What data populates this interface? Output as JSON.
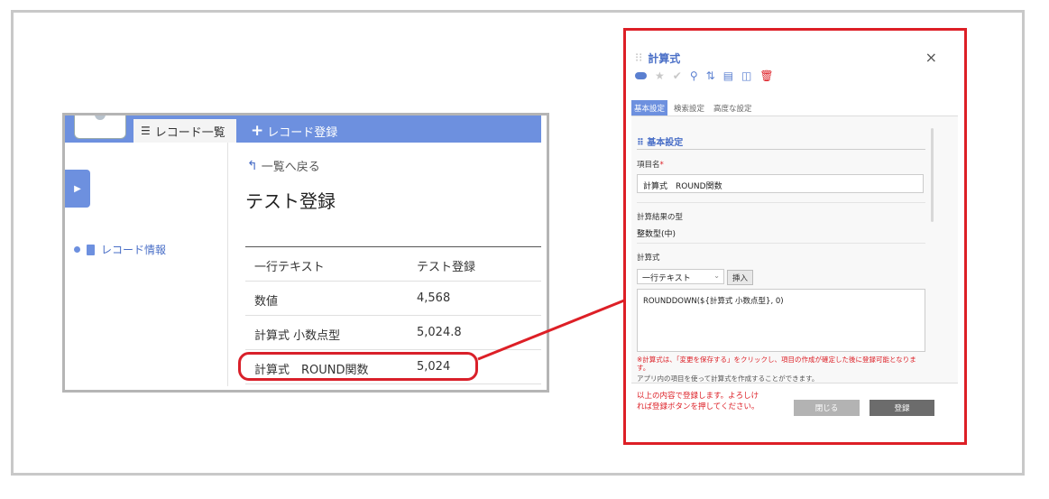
{
  "left": {
    "tabs": {
      "list_label": "レコード一覧",
      "add_label": "レコード登録"
    },
    "sidebar_item": "レコード情報",
    "back_label": "一覧へ戻る",
    "title": "テスト登録",
    "rows": [
      {
        "key": "一行テキスト",
        "value": "テスト登録"
      },
      {
        "key": "数値",
        "value": "4,568"
      },
      {
        "key": "計算式 小数点型",
        "value": "5,024.8"
      },
      {
        "key": "計算式　ROUND関数",
        "value": "5,024"
      }
    ]
  },
  "dialog": {
    "title": "計算式",
    "close_icon": "×",
    "tabs": [
      "基本設定",
      "検索設定",
      "高度な設定"
    ],
    "section": "基本設定",
    "field_name_label": "項目名",
    "required_mark": "*",
    "field_name_value": "計算式　ROUND関数",
    "result_type_label": "計算結果の型",
    "result_type_value": "整数型(中)",
    "formula_label": "計算式",
    "field_select": "一行テキスト",
    "insert_button": "挿入",
    "formula_value": "ROUNDDOWN(${計算式 小数点型}, 0)",
    "note": "※計算式は、「変更を保存する」をクリックし、項目の作成が確定した後に登録可能となります。",
    "note2": "アプリ内の項目を使って計算式を作成することができます。",
    "footer_message": "以上の内容で登録します。よろしければ登録ボタンを押してください。",
    "close_button": "閉じる",
    "register_button": "登録"
  },
  "colors": {
    "accent": "#6d90df",
    "highlight": "#dd1f26"
  }
}
